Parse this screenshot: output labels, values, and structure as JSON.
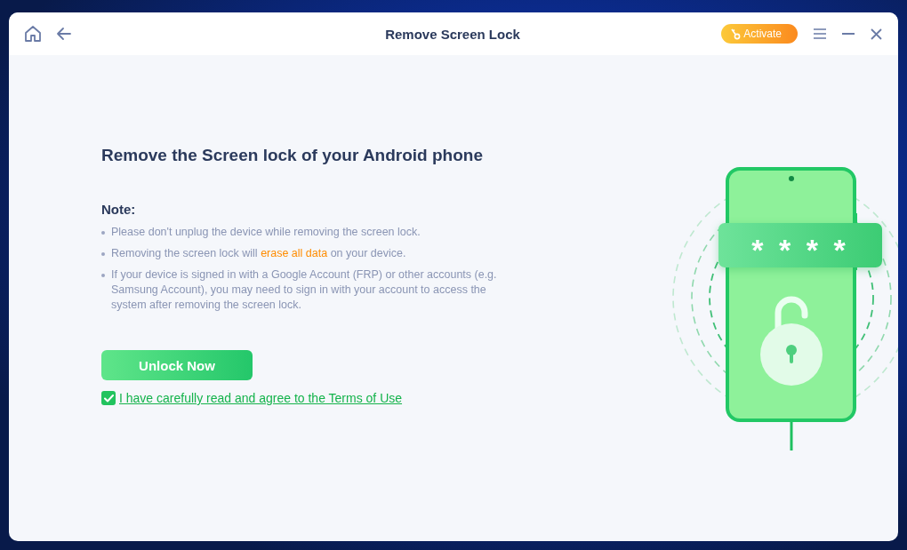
{
  "window": {
    "title": "Remove Screen Lock",
    "activate_label": "Activate"
  },
  "heading": "Remove the Screen lock of your Android phone",
  "note_title": "Note:",
  "notes": [
    "Please don't unplug the device while removing the screen lock.",
    "Removing the screen lock will **erase all data** on your device.",
    "If your device is signed in with a Google Account (FRP) or other accounts (e.g. Samsung Account), you may need to sign in with your account to access the system after removing the screen lock."
  ],
  "unlock_button": "Unlock Now",
  "agreement": {
    "label": "I have carefully read and agree to the Terms of Use",
    "checked": true
  },
  "illustration": {
    "password_mask": "* * * *"
  }
}
